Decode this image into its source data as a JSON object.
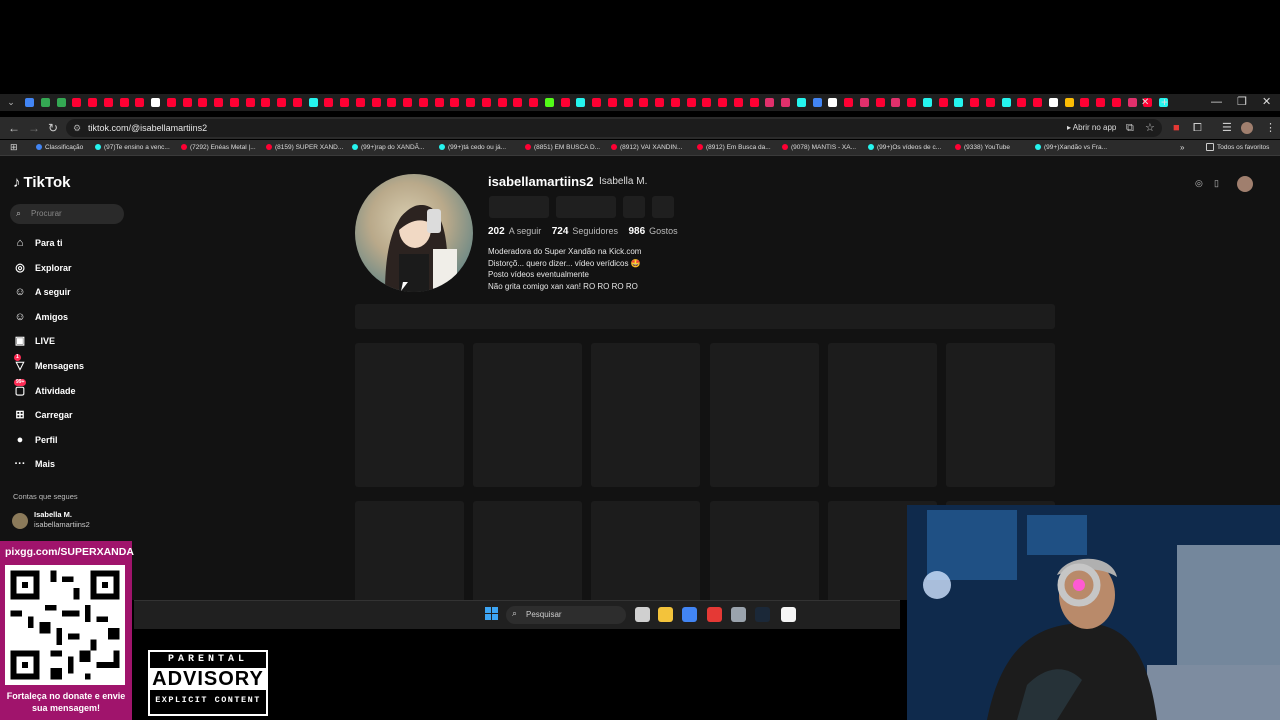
{
  "browser": {
    "tab_colors": [
      "#4285f4",
      "#34a853",
      "#34a853",
      "#ff0033",
      "#ff0033",
      "#ff0033",
      "#ff0033",
      "#ff0033",
      "#ffffff",
      "#ff0033",
      "#ff0033",
      "#ff0033",
      "#ff0033",
      "#ff0033",
      "#ff0033",
      "#ff0033",
      "#ff0033",
      "#ff0033",
      "#25f4ee",
      "#ff0033",
      "#ff0033",
      "#ff0033",
      "#ff0033",
      "#ff0033",
      "#ff0033",
      "#ff0033",
      "#ff0033",
      "#ff0033",
      "#ff0033",
      "#ff0033",
      "#ff0033",
      "#ff0033",
      "#ff0033",
      "#53fc18",
      "#ff0033",
      "#25f4ee",
      "#ff0033",
      "#ff0033",
      "#ff0033",
      "#ff0033",
      "#ff0033",
      "#ff0033",
      "#ff0033",
      "#ff0033",
      "#ff0033",
      "#ff0033",
      "#ff0033",
      "#e1306c",
      "#e1306c",
      "#25f4ee",
      "#4285f4",
      "#ffffff",
      "#ff0033",
      "#e1306c",
      "#ff0033",
      "#e1306c",
      "#ff0033",
      "#25f4ee",
      "#ff0033",
      "#25f4ee",
      "#ff0033",
      "#ff0033",
      "#25f4ee",
      "#ff0033",
      "#ff0033",
      "#ffffff",
      "#fbbc04",
      "#ff0033",
      "#ff0033",
      "#ff0033",
      "#e1306c",
      "#ff0033",
      "#25f4ee"
    ],
    "url": "tiktok.com/@isabellamartiins2",
    "open_in_app": "Abrir no app",
    "bookmarks": [
      {
        "label": "Classificação",
        "color": "#4285f4"
      },
      {
        "label": "(97)Te ensino a venc...",
        "color": "#25f4ee"
      },
      {
        "label": "(7292) Enéas Metal |...",
        "color": "#ff0033"
      },
      {
        "label": "(8159) SUPER XAND...",
        "color": "#ff0033"
      },
      {
        "label": "(99+)rap do XANDÃ...",
        "color": "#25f4ee"
      },
      {
        "label": "(99+)tá cedo ou já...",
        "color": "#25f4ee"
      },
      {
        "label": "(8851) EM BUSCA D...",
        "color": "#ff0033"
      },
      {
        "label": "(8912) VAI XANDIN...",
        "color": "#ff0033"
      },
      {
        "label": "(8912) Em Busca da...",
        "color": "#ff0033"
      },
      {
        "label": "(9078) MANTIS - XA...",
        "color": "#ff0033"
      },
      {
        "label": "(99+)Os vídeos de c...",
        "color": "#25f4ee"
      },
      {
        "label": "(9338) YouTube",
        "color": "#ff0033"
      },
      {
        "label": "(99+)Xandão vs Fra...",
        "color": "#25f4ee"
      }
    ],
    "all_bookmarks": "Todos os favoritos"
  },
  "tiktok": {
    "logo": "TikTok",
    "search_placeholder": "Procurar",
    "nav": [
      {
        "label": "Para ti",
        "icon": "home-icon",
        "glyph": "⌂"
      },
      {
        "label": "Explorar",
        "icon": "compass-icon",
        "glyph": "◎"
      },
      {
        "label": "A seguir",
        "icon": "user-plus-icon",
        "glyph": "☺"
      },
      {
        "label": "Amigos",
        "icon": "friends-icon",
        "glyph": "☺"
      },
      {
        "label": "LIVE",
        "icon": "live-icon",
        "glyph": "▣"
      },
      {
        "label": "Mensagens",
        "icon": "messages-icon",
        "glyph": "▽",
        "badge": "1"
      },
      {
        "label": "Atividade",
        "icon": "activity-icon",
        "glyph": "▢",
        "badge": "99+"
      },
      {
        "label": "Carregar",
        "icon": "upload-icon",
        "glyph": "⊞"
      },
      {
        "label": "Perfil",
        "icon": "profile-icon",
        "glyph": "●"
      },
      {
        "label": "Mais",
        "icon": "more-icon",
        "glyph": "···"
      }
    ],
    "following_header": "Contas que segues",
    "following_account": {
      "name": "Isabella M.",
      "username": "isabellamartiins2"
    },
    "profile": {
      "username": "isabellamartiins2",
      "nickname": "Isabella M.",
      "following_count": "202",
      "following_label": "A seguir",
      "followers_count": "724",
      "followers_label": "Seguidores",
      "likes_count": "986",
      "likes_label": "Gostos",
      "bio": [
        "Moderadora do Super Xandão na Kick.com",
        "Distorçõ... quero dizer... vídeo verídicos 🤩",
        "Posto vídeos eventualmente",
        "Não grita comigo xan xan! RO RO RO RO"
      ]
    }
  },
  "taskbar": {
    "search_placeholder": "Pesquisar",
    "apps": [
      {
        "name": "task-view-icon",
        "color": "#d0d0d0"
      },
      {
        "name": "file-explorer-icon",
        "color": "#f3c33b"
      },
      {
        "name": "chrome-icon",
        "color": "#4285f4"
      },
      {
        "name": "recorder-icon",
        "color": "#e53935"
      },
      {
        "name": "settings-icon",
        "color": "#9aa3ad"
      },
      {
        "name": "steam-icon",
        "color": "#1b2838"
      },
      {
        "name": "notepad-icon",
        "color": "#f5f5f5"
      }
    ]
  },
  "overlay": {
    "donate_url": "pixgg.com/SUPERXANDA",
    "donate_text": "Fortaleça no donate e envie sua mensagem!",
    "advisory_top": "PARENTAL",
    "advisory_mid": "ADVISORY",
    "advisory_bottom": "EXPLICIT CONTENT"
  }
}
